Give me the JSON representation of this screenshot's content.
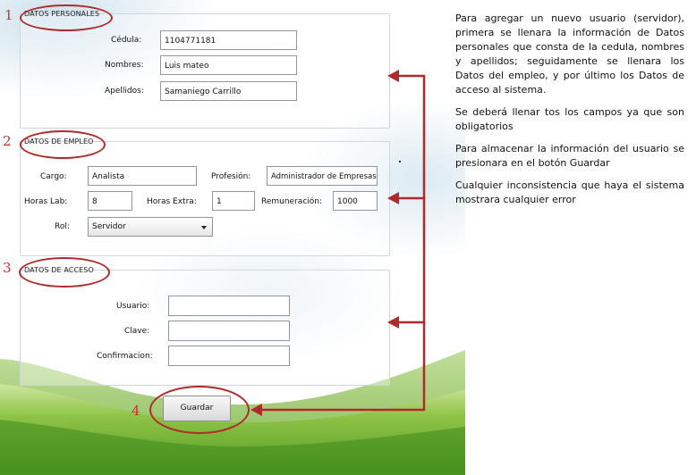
{
  "sections": {
    "personal": {
      "number": "1",
      "legend": "DATOS PERSONALES"
    },
    "employment": {
      "number": "2",
      "legend": "DATOS DE EMPLEO"
    },
    "access": {
      "number": "3",
      "legend": "DATOS DE ACCESO"
    }
  },
  "personal": {
    "cedula_label": "Cédula:",
    "cedula_value": "1104771181",
    "nombres_label": "Nombres:",
    "nombres_value": "Luis mateo",
    "apellidos_label": "Apellidos:",
    "apellidos_value": "Samaniego Carrillo"
  },
  "employment": {
    "cargo_label": "Cargo:",
    "cargo_value": "Analista",
    "profesion_label": "Profesión:",
    "profesion_value": "Administrador de Empresas",
    "horas_lab_label": "Horas Lab:",
    "horas_lab_value": "8",
    "horas_extra_label": "Horas Extra:",
    "horas_extra_value": "1",
    "remuneracion_label": "Remuneración:",
    "remuneracion_value": "1000",
    "rol_label": "Rol:",
    "rol_value": "Servidor"
  },
  "access": {
    "usuario_label": "Usuario:",
    "usuario_value": "",
    "clave_label": "Clave:",
    "clave_value": "",
    "confirmacion_label": "Confirmacion:",
    "confirmacion_value": ""
  },
  "save": {
    "number": "4",
    "label": "Guardar"
  },
  "description": [
    "Para agregar un nuevo usuario (servidor), primera se llenara la información de Datos personales que consta de la cedula, nombres y apellidos; seguidamente se llenara los Datos del empleo, y por último los Datos de acceso al sistema.",
    "Se deberá llenar tos los campos ya que son obligatorios",
    "Para almacenar la información del usuario se presionara en el botón Guardar",
    "Cualquier inconsistencia que haya el sistema mostrara cualquier error"
  ],
  "colors": {
    "annotation": "#b02a2a",
    "number": "#c9302c",
    "grass": "#7fb83a"
  }
}
